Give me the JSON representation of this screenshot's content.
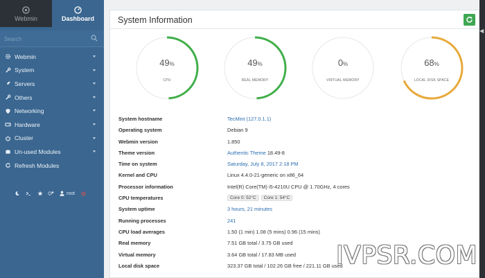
{
  "sidebar": {
    "tabs": {
      "webmin": "Webmin",
      "dashboard": "Dashboard"
    },
    "search_placeholder": "Search",
    "items": [
      {
        "label": "Webmin",
        "icon": "gear-icon"
      },
      {
        "label": "System",
        "icon": "wrench-icon"
      },
      {
        "label": "Servers",
        "icon": "rocket-icon"
      },
      {
        "label": "Others",
        "icon": "wrench-icon"
      },
      {
        "label": "Networking",
        "icon": "shield-icon"
      },
      {
        "label": "Hardware",
        "icon": "hdd-icon"
      },
      {
        "label": "Cluster",
        "icon": "power-icon"
      },
      {
        "label": "Un-used Modules",
        "icon": "puzzle-icon"
      },
      {
        "label": "Refresh Modules",
        "icon": "refresh-icon"
      }
    ],
    "footer": {
      "user": "root"
    }
  },
  "panel": {
    "title": "System Information"
  },
  "gauges": [
    {
      "value": "49",
      "unit": "%",
      "label": "CPU",
      "percent": 49,
      "color": "#3fae49"
    },
    {
      "value": "49",
      "unit": "%",
      "label": "REAL MEMORY",
      "percent": 49,
      "color": "#3fae49"
    },
    {
      "value": "0",
      "unit": "%",
      "label": "VIRTUAL MEMORY",
      "percent": 0,
      "color": "#3fae49"
    },
    {
      "value": "68",
      "unit": "%",
      "label": "LOCAL DISK SPACE",
      "percent": 68,
      "color": "#e8a93a"
    }
  ],
  "info": {
    "hostname": {
      "key": "System hostname",
      "value": "TecMint (127.0.1.1)"
    },
    "os": {
      "key": "Operating system",
      "value": "Debian 9"
    },
    "webmin_version": {
      "key": "Webmin version",
      "value": "1.850"
    },
    "theme": {
      "key": "Theme version",
      "link": "Authentic Theme",
      "value": "18.49-8"
    },
    "time": {
      "key": "Time on system",
      "value": "Saturday, July 8, 2017 2:18 PM"
    },
    "kernel": {
      "key": "Kernel and CPU",
      "value": "Linux 4.4.0-21-generic on x86_64"
    },
    "processor": {
      "key": "Processor information",
      "value": "Intel(R) Core(TM) i5-4210U CPU @ 1.70GHz, 4 cores"
    },
    "temps": {
      "key": "CPU temperatures",
      "core0": "Core 0: 52°C",
      "core1": "Core 1: 54°C"
    },
    "uptime": {
      "key": "System uptime",
      "value": "3 hours, 21 minutes"
    },
    "processes": {
      "key": "Running processes",
      "value": "241"
    },
    "load": {
      "key": "CPU load averages",
      "value": "1.50 (1 min) 1.08 (5 mins) 0.96 (15 mins)"
    },
    "real_mem": {
      "key": "Real memory",
      "value": "7.51 GB total / 3.75 GB used"
    },
    "virt_mem": {
      "key": "Virtual memory",
      "value": "3.64 GB total / 17.83 MB used"
    },
    "disk": {
      "key": "Local disk space",
      "value": "323.37 GB total / 102.26 GB free / 221.11 GB used"
    }
  },
  "watermark": "IVPSR.COM",
  "colors": {
    "sidebar": "#3a6690",
    "accent": "#2b6cb0",
    "green": "#3fae49",
    "orange": "#e8a93a"
  }
}
